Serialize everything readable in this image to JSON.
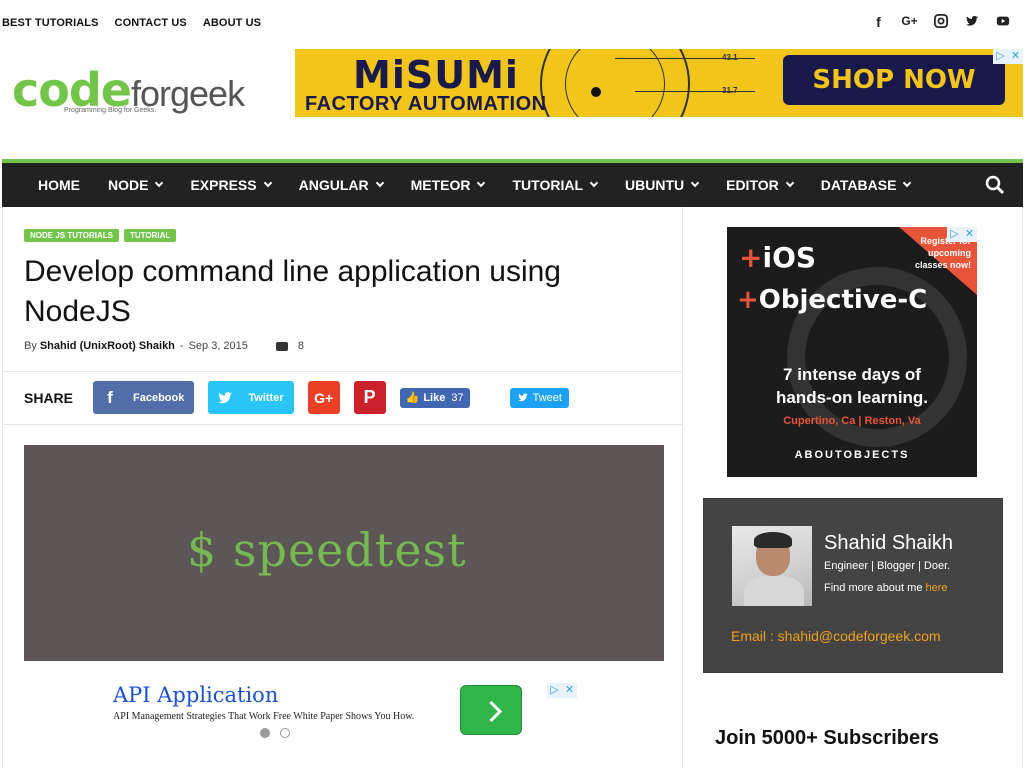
{
  "toplinks": [
    "BEST TUTORIALS",
    "CONTACT US",
    "ABOUT US"
  ],
  "social_icons": [
    "facebook-icon",
    "google-plus-icon",
    "instagram-icon",
    "twitter-icon",
    "youtube-icon"
  ],
  "logo": {
    "code": "code",
    "forgeek": "forgeek",
    "tagline": "Programming Blog for Geeks."
  },
  "header_ad": {
    "brand": "MiSUMi",
    "sub": "FACTORY AUTOMATION",
    "cta": "SHOP NOW >>>",
    "num1": "43.1",
    "num2": "31.7"
  },
  "nav": {
    "items": [
      "HOME",
      "NODE",
      "EXPRESS",
      "ANGULAR",
      "METEOR",
      "TUTORIAL",
      "UBUNTU",
      "EDITOR",
      "DATABASE"
    ],
    "has_dropdown": [
      false,
      true,
      true,
      true,
      true,
      true,
      true,
      true,
      true
    ]
  },
  "post": {
    "categories": [
      "NODE JS TUTORIALS",
      "TUTORIAL"
    ],
    "title": "Develop command line application using NodeJS",
    "by": "By",
    "author": "Shahid (UnixRoot) Shaikh",
    "date": "Sep 3, 2015",
    "comments": "8",
    "share_label": "SHARE",
    "facebook": "Facebook",
    "twitter": "Twitter",
    "like": "Like",
    "like_count": "37",
    "tweet": "Tweet",
    "feature_text": "$ speedtest"
  },
  "inline_ad": {
    "headline": "API Application",
    "desc": "API Management Strategies That Work Free White Paper Shows You How."
  },
  "side_ad": {
    "l1": "iOS",
    "l2": "Objective-C",
    "reg": "Register for upcoming classes now!",
    "l3a": "7 intense days of",
    "l3b": "hands-on learning.",
    "l4": "Cupertino, Ca | Reston, Va",
    "l5": "ABOUTOBJECTS"
  },
  "about": {
    "name": "Shahid Shaikh",
    "role": "Engineer | Blogger | Doer.",
    "more": "Find more about me",
    "here": "here",
    "email": "Email : shahid@codeforgeek.com"
  },
  "join": "Join 5000+ Subscribers",
  "colors": {
    "accent": "#73c44b",
    "nav_bg": "#222222",
    "about_bg": "#444444",
    "link_orange": "#f0a020"
  }
}
